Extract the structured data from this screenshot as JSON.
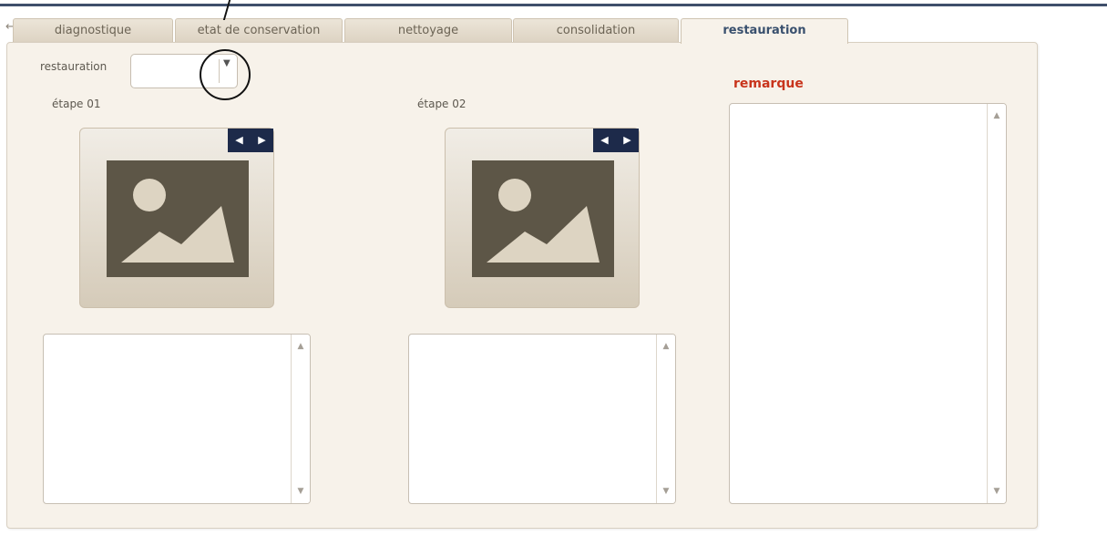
{
  "tabs": [
    {
      "label": "diagnostique"
    },
    {
      "label": "etat de conservation"
    },
    {
      "label": "nettoyage"
    },
    {
      "label": "consolidation"
    },
    {
      "label": "restauration",
      "active": true
    }
  ],
  "back_icon": "←",
  "form": {
    "restauration_label": "restauration",
    "select_value": "",
    "select_arrow": "▼"
  },
  "steps": [
    {
      "label": "étape 01",
      "prev": "◀",
      "next": "▶"
    },
    {
      "label": "étape 02",
      "prev": "◀",
      "next": "▶"
    }
  ],
  "remarque": {
    "title": "remarque"
  },
  "scroll": {
    "up": "▲",
    "down": "▼"
  },
  "colors": {
    "accent_title": "#c8341c",
    "active_tab": "#39506e",
    "nav_bg": "#1d2a4a"
  }
}
